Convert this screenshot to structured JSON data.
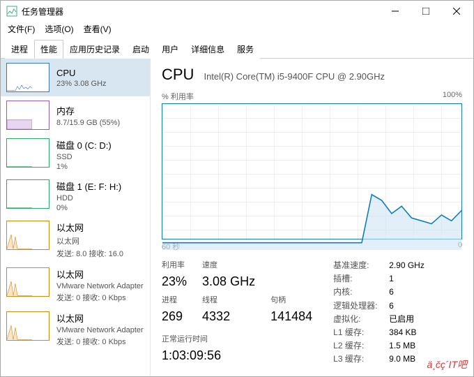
{
  "window": {
    "title": "任务管理器"
  },
  "menus": {
    "file": "文件(F)",
    "options": "选项(O)",
    "view": "查看(V)"
  },
  "tabs": [
    "进程",
    "性能",
    "应用历史记录",
    "启动",
    "用户",
    "详细信息",
    "服务"
  ],
  "activeTab": 1,
  "sidebar": [
    {
      "name": "CPU",
      "sub": "23% 3.08 GHz",
      "kind": "cpu",
      "selected": true
    },
    {
      "name": "内存",
      "sub": "8.7/15.9 GB (55%)",
      "kind": "mem"
    },
    {
      "name": "磁盘 0 (C: D:)",
      "sub": "SSD",
      "sub2": "1%",
      "kind": "disk"
    },
    {
      "name": "磁盘 1 (E: F: H:)",
      "sub": "HDD",
      "sub2": "0%",
      "kind": "disk"
    },
    {
      "name": "以太网",
      "sub": "以太网",
      "sub2": "发送: 8.0 接收: 16.0",
      "kind": "net"
    },
    {
      "name": "以太网",
      "sub": "VMware Network Adapter",
      "sub2": "发送: 0 接收: 0 Kbps",
      "kind": "net"
    },
    {
      "name": "以太网",
      "sub": "VMware Network Adapter",
      "sub2": "发送: 0 接收: 0 Kbps",
      "kind": "net"
    }
  ],
  "main": {
    "title": "CPU",
    "model": "Intel(R) Core(TM) i5-9400F CPU @ 2.90GHz",
    "chartLabelLeft": "% 利用率",
    "chartLabelRight": "100%",
    "xLeft": "60 秒",
    "xRight": "0",
    "statsLeft": {
      "util_lbl": "利用率",
      "util_val": "23%",
      "speed_lbl": "速度",
      "speed_val": "3.08 GHz",
      "proc_lbl": "进程",
      "proc_val": "269",
      "thr_lbl": "线程",
      "thr_val": "4332",
      "hnd_lbl": "句柄",
      "hnd_val": "141484",
      "uptime_lbl": "正常运行时间",
      "uptime_val": "1:03:09:56"
    },
    "statsRight": [
      {
        "k": "基准速度:",
        "v": "2.90 GHz"
      },
      {
        "k": "插槽:",
        "v": "1"
      },
      {
        "k": "内核:",
        "v": "6"
      },
      {
        "k": "逻辑处理器:",
        "v": "6"
      },
      {
        "k": "虚拟化:",
        "v": "已启用"
      },
      {
        "k": "L1 缓存:",
        "v": "384 KB"
      },
      {
        "k": "L2 缓存:",
        "v": "1.5 MB"
      },
      {
        "k": "L3 缓存:",
        "v": "9.0 MB"
      }
    ]
  },
  "watermark": "ä¸čç´IT吧",
  "chart_data": {
    "type": "line",
    "title": "% 利用率",
    "xlabel": "60 秒 → 0",
    "ylabel": "% 利用率",
    "ylim": [
      0,
      100
    ],
    "xlim": [
      60,
      0
    ],
    "x": [
      60,
      58,
      56,
      54,
      52,
      50,
      48,
      46,
      44,
      42,
      40,
      38,
      36,
      34,
      32,
      30,
      28,
      26,
      24,
      22,
      20,
      18,
      16,
      14,
      12,
      10,
      8,
      6,
      4,
      2,
      0
    ],
    "values": [
      5,
      5,
      5,
      5,
      5,
      5,
      5,
      5,
      5,
      5,
      5,
      5,
      5,
      5,
      5,
      5,
      5,
      5,
      5,
      5,
      5,
      38,
      34,
      25,
      30,
      22,
      20,
      18,
      24,
      20,
      27
    ]
  }
}
